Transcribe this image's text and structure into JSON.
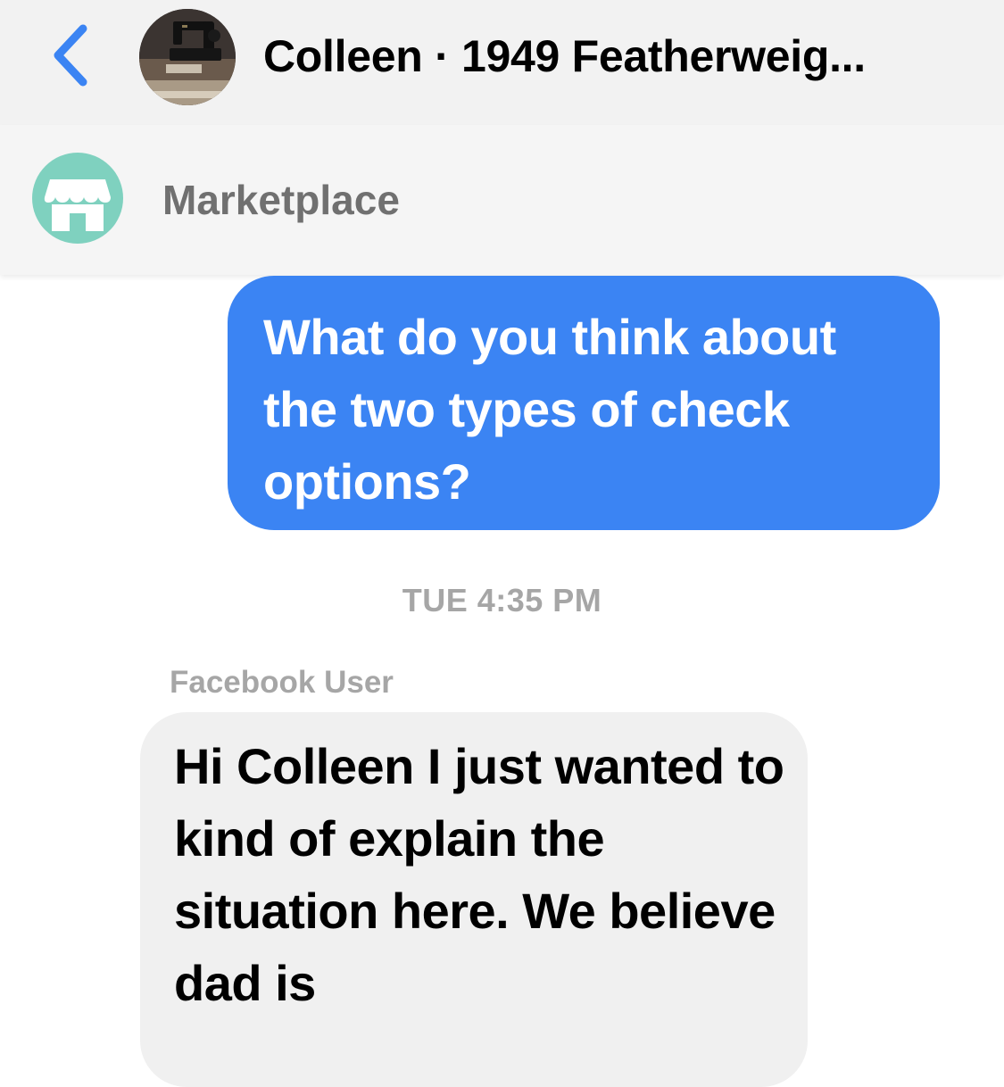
{
  "header": {
    "title": "Colleen · 1949 Featherweig...",
    "back_icon": "chevron-left-icon",
    "avatar": "sewing-machine-photo"
  },
  "marketplace": {
    "label": "Marketplace",
    "icon": "storefront-icon",
    "icon_color": "#7fd1bf"
  },
  "messages": [
    {
      "direction": "outgoing",
      "text": "What do you think about the two types of check options?",
      "bubble_color": "#3b84f3"
    },
    {
      "direction": "incoming",
      "sender": "Facebook User",
      "text": "Hi Colleen I just wanted to kind of explain the situation here. We believe dad is",
      "bubble_color": "#f0f0f0"
    }
  ],
  "timestamp": "TUE 4:35 PM",
  "colors": {
    "accent": "#3b84f3",
    "header_bg": "#f2f2f2"
  }
}
